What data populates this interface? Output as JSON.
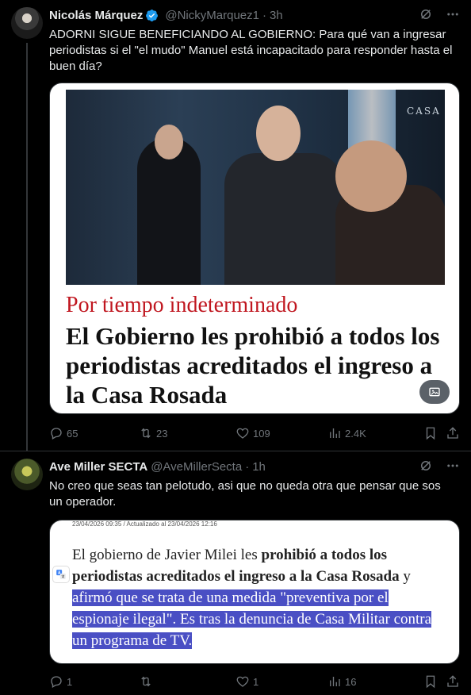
{
  "tweet1": {
    "author_name": "Nicolás Márquez",
    "handle": "@NickyMarquez1",
    "dot": "·",
    "time": "3h",
    "text": "ADORNI SIGUE BENEFICIANDO AL GOBIERNO: Para qué van a ingresar periodistas si el \"el mudo\" Manuel está incapacitado para responder hasta el buen día?",
    "media": {
      "sign_text": "CASA",
      "kicker": "Por tiempo indeterminado",
      "headline": "El Gobierno les prohibió a todos los periodistas acreditados el ingreso a la Casa Rosada"
    },
    "stats": {
      "replies": "65",
      "retweets": "23",
      "likes": "109",
      "views": "2.4K"
    }
  },
  "tweet2": {
    "author_name": "Ave Miller SECTA",
    "handle": "@AveMillerSecta",
    "dot": "·",
    "time": "1h",
    "text": "No creo que seas tan pelotudo, asi que no queda otra que pensar que sos un operador.",
    "media": {
      "meta": "23/04/2026 09:35 / Actualizado al 23/04/2026 12:16",
      "p1": "El gobierno de Javier Milei les ",
      "p1_bold": "prohibió a todos los periodistas acreditados el ingreso a la Casa Rosada",
      "p2": " y ",
      "p3_highlight": "afirmó que se trata de una medida \"preventiva por el espionaje ilegal\". Es tras la denuncia de Casa Militar contra un programa de TV."
    },
    "stats": {
      "replies": "1",
      "retweets": "",
      "likes": "1",
      "views": "16"
    }
  },
  "colors": {
    "background": "#000000",
    "text": "#e7e9ea",
    "muted": "#71767b",
    "verified": "#1d9bf0",
    "kicker": "#c0161f",
    "highlight": "#4a4fc4"
  }
}
